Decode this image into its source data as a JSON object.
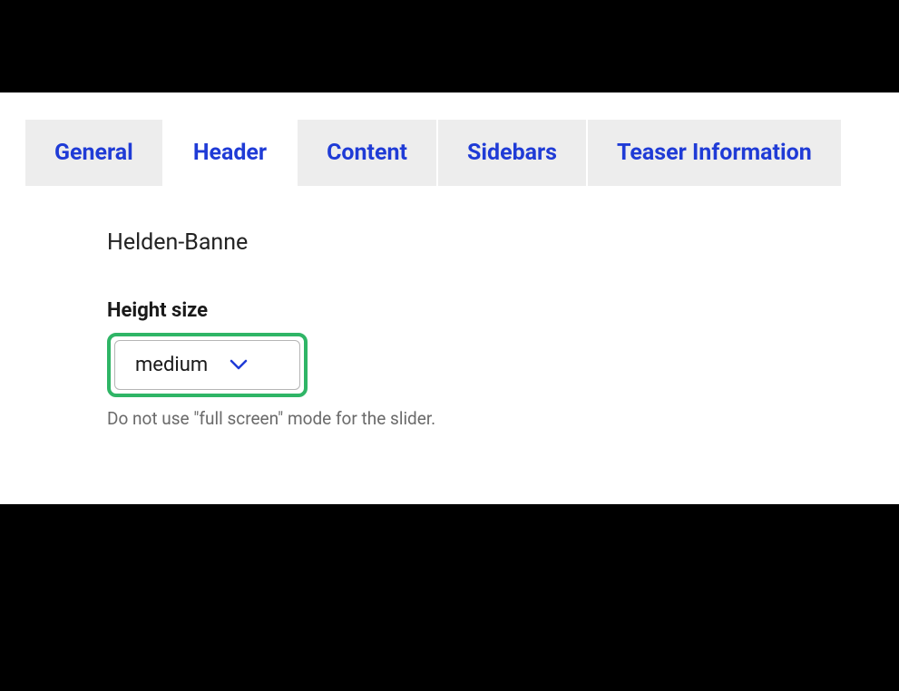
{
  "tabs": [
    {
      "label": "General",
      "active": false
    },
    {
      "label": "Header",
      "active": true
    },
    {
      "label": "Content",
      "active": false
    },
    {
      "label": "Sidebars",
      "active": false
    },
    {
      "label": "Teaser Information",
      "active": false
    }
  ],
  "section": {
    "title": "Helden-Banne"
  },
  "heightSize": {
    "label": "Height size",
    "value": "medium",
    "help": "Do not use \"full screen\" mode for the slider."
  }
}
